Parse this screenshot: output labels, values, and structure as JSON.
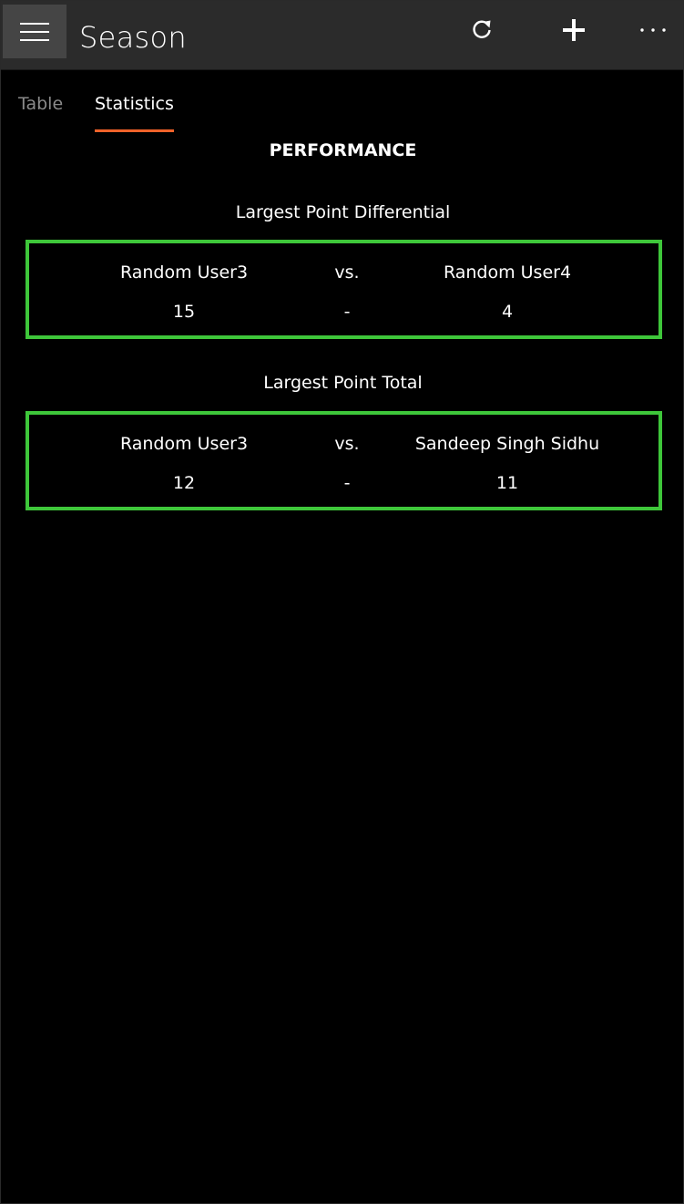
{
  "header": {
    "title": "Season",
    "icons": {
      "menu": "hamburger-menu-icon",
      "refresh": "refresh-icon",
      "add": "plus-icon",
      "more": "more-ellipsis-icon"
    }
  },
  "tabs": [
    {
      "label": "Table",
      "selected": false
    },
    {
      "label": "Statistics",
      "selected": true
    }
  ],
  "colors": {
    "accent": "#f0622a",
    "card_border": "#3ec63a",
    "background": "#000000",
    "titlebar": "#2b2b2b"
  },
  "statistics": {
    "heading": "PERFORMANCE",
    "sections": [
      {
        "title": "Largest Point Differential",
        "player1": "Random User3",
        "vs": "vs.",
        "player2": "Random User4",
        "score1": "15",
        "separator": "-",
        "score2": "4"
      },
      {
        "title": "Largest Point Total",
        "player1": "Random User3",
        "vs": "vs.",
        "player2": "Sandeep Singh Sidhu",
        "score1": "12",
        "separator": "-",
        "score2": "11"
      }
    ]
  }
}
